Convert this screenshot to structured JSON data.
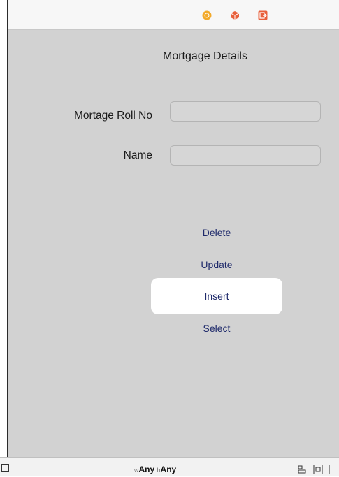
{
  "window": {
    "dock_icons": [
      "view-controller-icon",
      "first-responder-icon",
      "exit-icon"
    ]
  },
  "form": {
    "title": "Mortgage Details",
    "fields": [
      {
        "label": "Mortage Roll No",
        "value": "",
        "placeholder": ""
      },
      {
        "label": "Name",
        "value": "",
        "placeholder": ""
      }
    ]
  },
  "actions": {
    "delete": "Delete",
    "update": "Update",
    "insert": "Insert",
    "select": "Select"
  },
  "bottom_bar": {
    "width_prefix": "w",
    "width_value": "Any",
    "height_prefix": "h",
    "height_value": "Any"
  },
  "colors": {
    "canvas": "#d2d2d2",
    "button_text": "#1f2a6b",
    "highlight": "#ffffff"
  }
}
